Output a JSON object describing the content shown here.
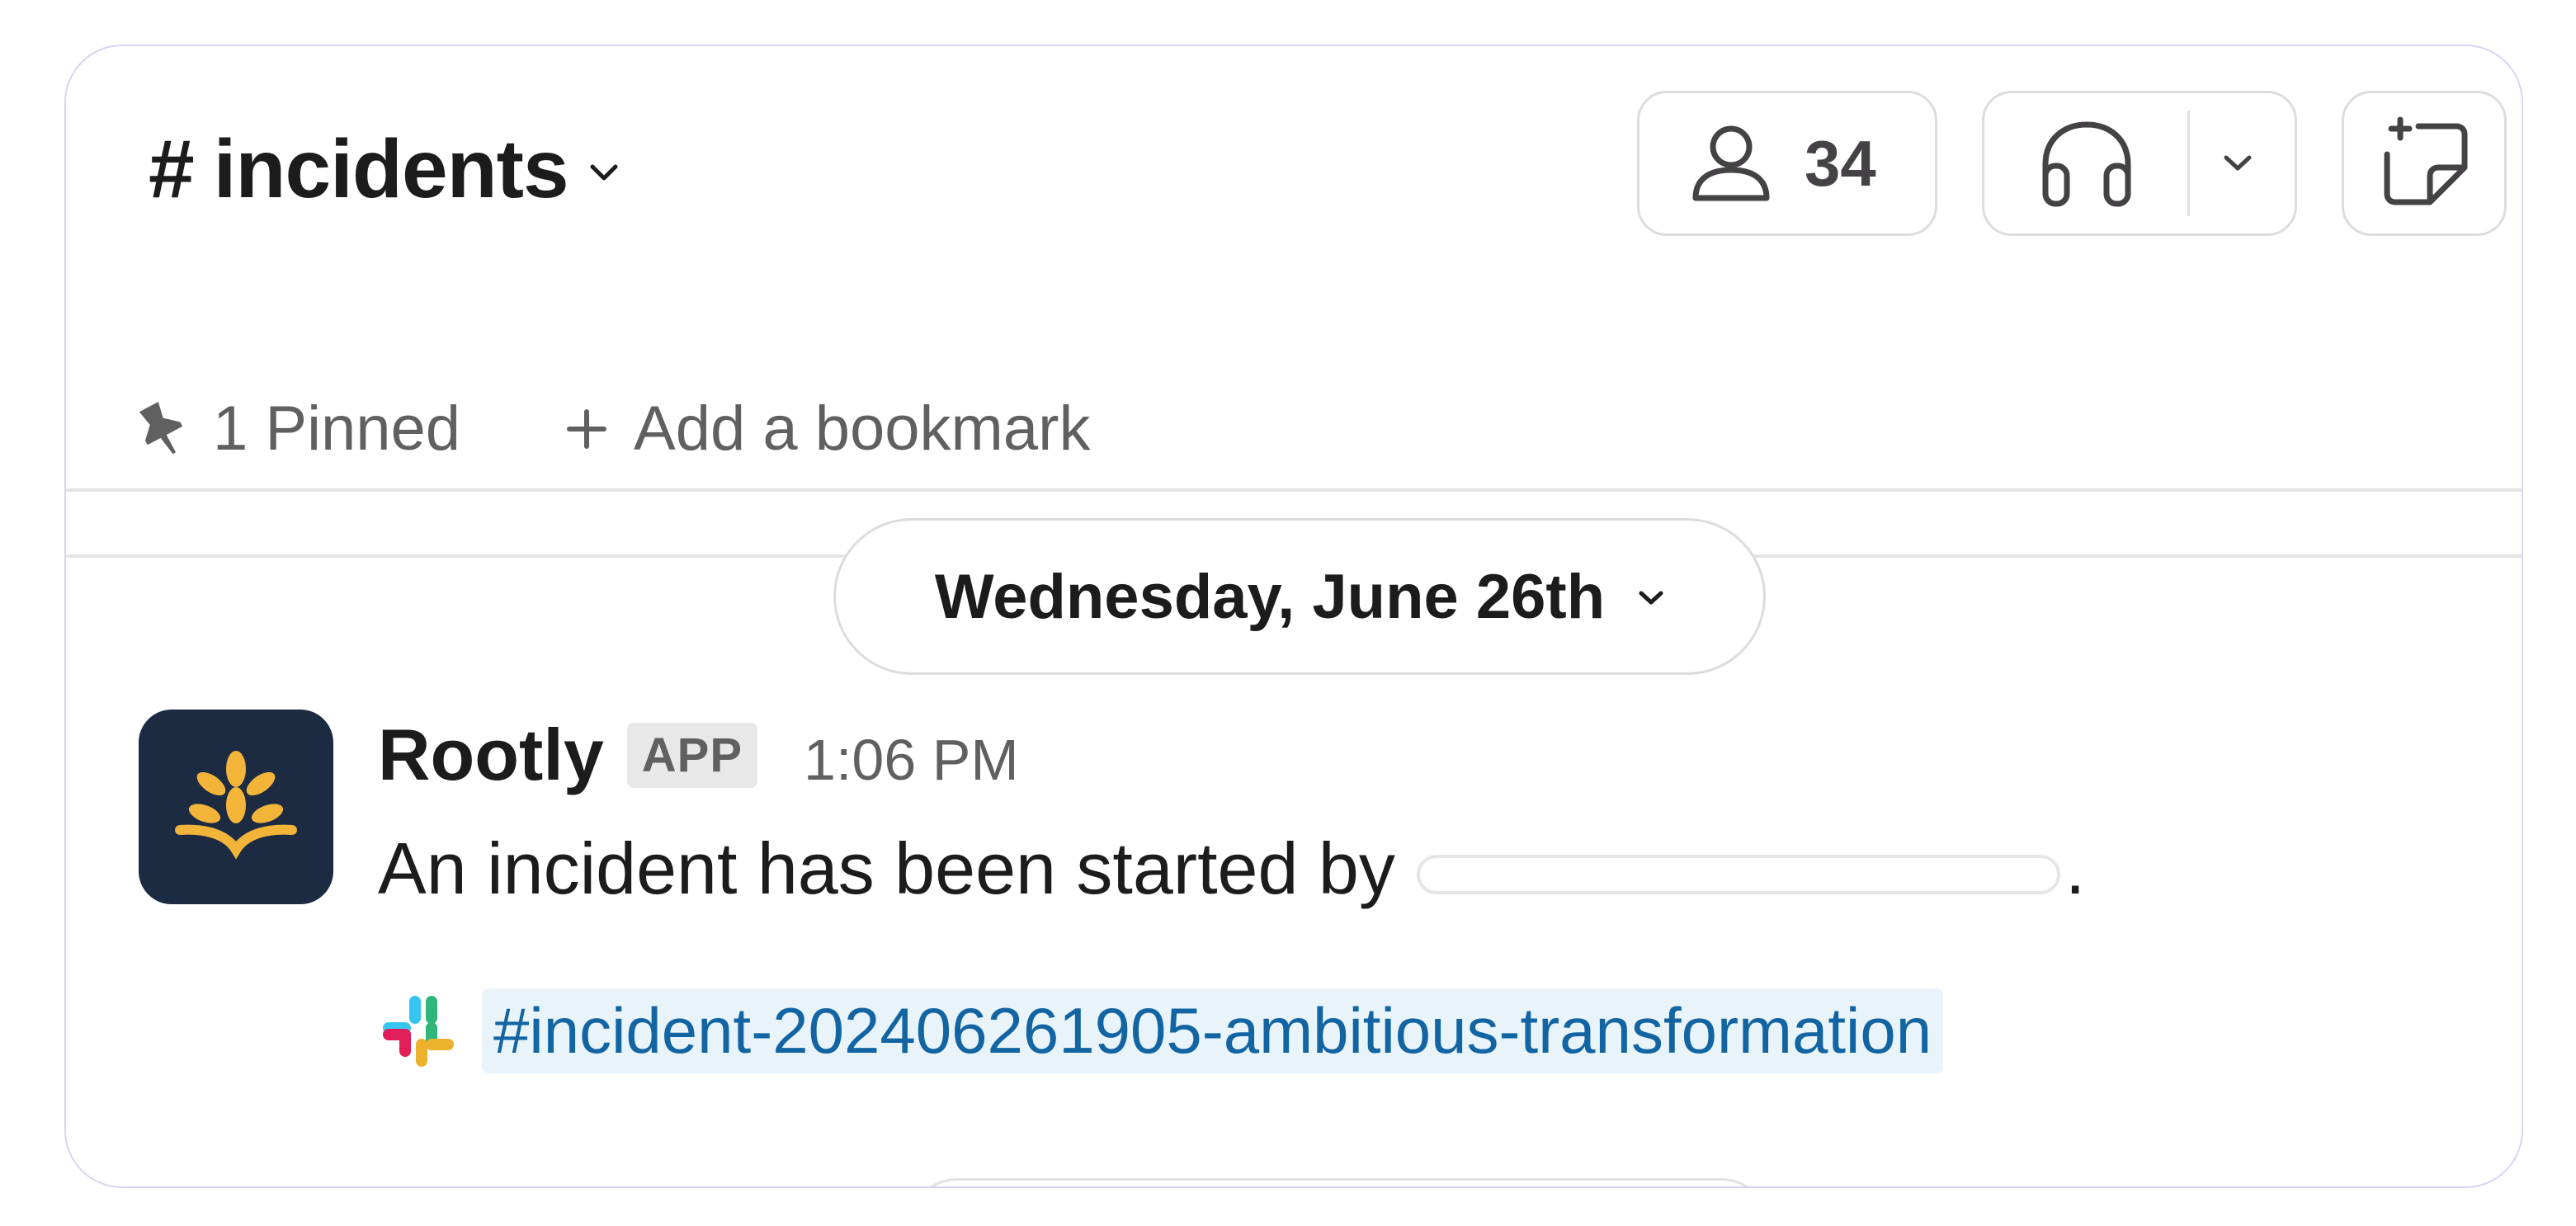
{
  "header": {
    "hash": "#",
    "channel_name": "incidents",
    "member_count": "34"
  },
  "bookmarks": {
    "pinned_label": "1 Pinned",
    "add_bookmark_label": "Add a bookmark"
  },
  "date_divider": "Wednesday, June 26th",
  "message": {
    "sender": "Rootly",
    "badge": "APP",
    "time": "1:06 PM",
    "text": "An incident has been started by",
    "mention_redacted": true,
    "period": ".",
    "channel_link": "#incident-202406261905-ambitious-transformation"
  },
  "icons": {
    "members": "person-icon",
    "huddle": "headphones-icon",
    "canvas": "new-canvas-icon",
    "pin": "pin-icon",
    "add": "plus-icon",
    "slack": "slack-logo-icon",
    "avatar": "rootly-logo"
  },
  "colors": {
    "frame_border": "#d9d4f2",
    "link": "#1264a3",
    "link_bg": "#e8f4fa",
    "avatar_bg": "#1c2a42",
    "avatar_accent": "#f2b53a"
  }
}
